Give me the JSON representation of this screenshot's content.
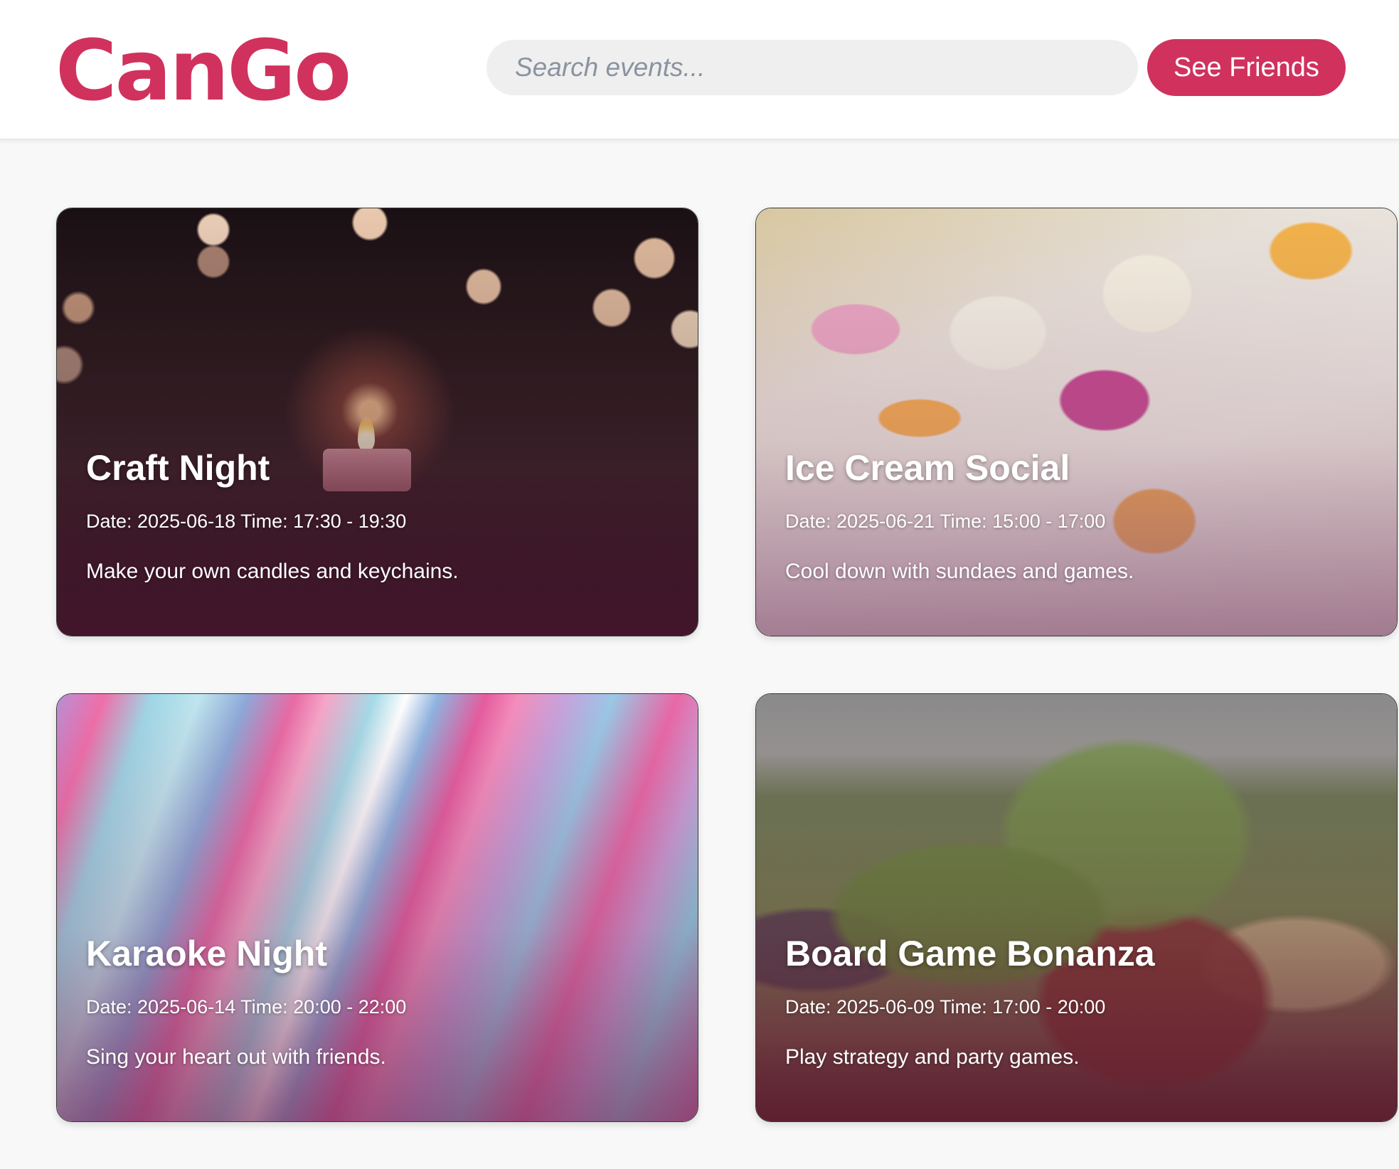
{
  "header": {
    "logo": "CanGo",
    "search_placeholder": "Search events...",
    "friends_button": "See Friends"
  },
  "theme": {
    "accent": "#d0325d",
    "background": "#f8f8f8"
  },
  "events": [
    {
      "title": "Craft Night",
      "meta": "Date: 2025-06-18 Time: 17:30 - 19:30",
      "description": "Make your own candles and keychains."
    },
    {
      "title": "Ice Cream Social",
      "meta": "Date: 2025-06-21 Time: 15:00 - 17:00",
      "description": "Cool down with sundaes and games."
    },
    {
      "title": "Karaoke Night",
      "meta": "Date: 2025-06-14 Time: 20:00 - 22:00",
      "description": "Sing your heart out with friends."
    },
    {
      "title": "Board Game Bonanza",
      "meta": "Date: 2025-06-09 Time: 17:00 - 20:00",
      "description": "Play strategy and party games."
    }
  ]
}
